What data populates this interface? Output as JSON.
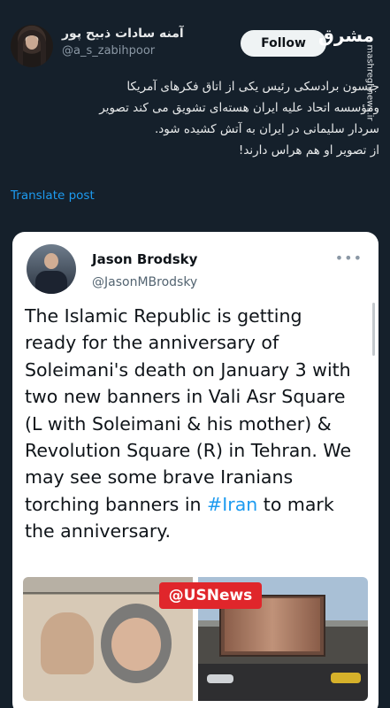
{
  "tweet": {
    "display_name": "آمنه سادات ذبیح پور",
    "handle": "@a_s_zabihpoor",
    "follow_label": "Follow",
    "body_lines": [
      "جیسون برادسکی رئیس یکی از اتاق فکرهای آمریکا",
      "ومؤسسه اتحاد علیه ایران هسته‌ای تشویق می کند تصویر",
      "سردار سلیمانی در ایران به آتش کشیده شود.",
      "از تصویر او هم هراس دارند!"
    ],
    "translate_label": "Translate post"
  },
  "watermark": {
    "logo_text": "مشرق",
    "site_text": "mashreghnews.ir"
  },
  "quote": {
    "name": "Jason Brodsky",
    "handle": "@JasonMBrodsky",
    "more_label": "•••",
    "text_before_hashtag": "The Islamic Republic is getting ready for the anniversary of Soleimani's death on January 3 with two new banners in Vali Asr Square (L with Soleimani & his mother) & Revolution Square (R) in Tehran. We may see some brave Iranians torching banners in ",
    "hashtag": "#Iran",
    "text_after_hashtag": " to mark the anniversary.",
    "media_badge": "@USNews"
  }
}
